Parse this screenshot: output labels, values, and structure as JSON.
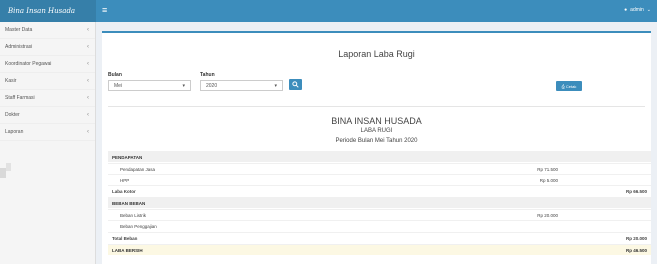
{
  "app": {
    "brand": "Bina Insan Husada",
    "user": "admin"
  },
  "sidebar": {
    "items": [
      {
        "label": "Master Data"
      },
      {
        "label": "Administrasi"
      },
      {
        "label": "Koordinator Pegawai"
      },
      {
        "label": "Kasir"
      },
      {
        "label": "Staff Farmasi"
      },
      {
        "label": "Dokter"
      },
      {
        "label": "Laporan"
      }
    ]
  },
  "main": {
    "title": "Laporan Laba Rugi",
    "filters": {
      "bulan_label": "Bulan",
      "bulan_value": "Mei",
      "tahun_label": "Tahun",
      "tahun_value": "2020"
    },
    "print_label": "Cetak"
  },
  "report": {
    "company": "BINA INSAN HUSADA",
    "subtitle": "LABA RUGI",
    "period": "Periode Bulan Mei Tahun 2020",
    "rows": [
      {
        "label": "PENDAPATAN",
        "c1": "",
        "c2": ""
      },
      {
        "label": "Pendapatan Jasa",
        "c1": "Rp 71.500",
        "c2": ""
      },
      {
        "label": "HPP",
        "c1": "Rp 5.000",
        "c2": ""
      },
      {
        "label": "Laba Kotor",
        "c1": "",
        "c2": "Rp 66.500"
      },
      {
        "label": "BEBAN BEBAN",
        "c1": "",
        "c2": ""
      },
      {
        "label": "Beban Listrik",
        "c1": "Rp 20.000",
        "c2": ""
      },
      {
        "label": "Beban Penggajian",
        "c1": "",
        "c2": ""
      },
      {
        "label": "Total Beban",
        "c1": "",
        "c2": "Rp 20.000"
      },
      {
        "label": "LABA BERSIH",
        "c1": "",
        "c2": "Rp 46.500"
      }
    ]
  }
}
